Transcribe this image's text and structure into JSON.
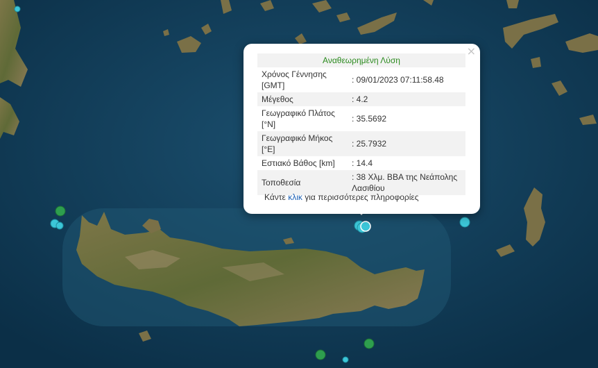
{
  "popup": {
    "title": "Αναθεωρημένη Λύση",
    "close_glyph": "×",
    "rows": [
      {
        "label": "Χρόνος Γέννησης [GMT]",
        "value": ": 09/01/2023 07:11:58.48"
      },
      {
        "label": "Μέγεθος",
        "value": ": 4.2"
      },
      {
        "label": "Γεωγραφικό Πλάτος [°N]",
        "value": ": 35.5692"
      },
      {
        "label": "Γεωγραφικό Μήκος [°E]",
        "value": ": 25.7932"
      },
      {
        "label": "Εστιακό Βάθος [km]",
        "value": ": 14.4"
      },
      {
        "label": "Τοποθεσία",
        "value": ": 38 Χλμ. ΒΒΑ της Νεάπολης Λασιθίου"
      }
    ],
    "footer_prefix": "Κάντε",
    "footer_link": "κλικ",
    "footer_suffix": "για περισσότερες πληροφορίες"
  },
  "colors": {
    "sea": "#0e3a55",
    "land": "#6e6a43",
    "marker_recent": "#3cc6d8",
    "marker_older": "#2e9e4e"
  }
}
